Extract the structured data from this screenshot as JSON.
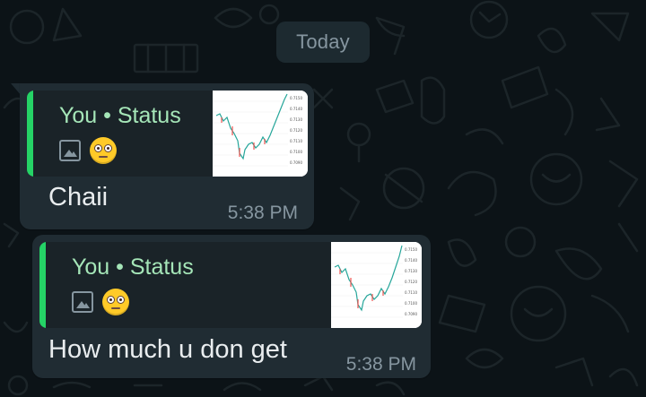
{
  "date_chip": {
    "label": "Today"
  },
  "messages": [
    {
      "quote": {
        "title": "You • Status",
        "media_icon": "image-icon",
        "emoji": "flushed-face"
      },
      "text": "Chaii",
      "time": "5:38 PM"
    },
    {
      "quote": {
        "title": "You • Status",
        "media_icon": "image-icon",
        "emoji": "flushed-face"
      },
      "text": "How much u don get",
      "time": "5:38 PM"
    }
  ],
  "colors": {
    "background": "#0c1317",
    "bubble": "#202c33",
    "quote_bar": "#25d366",
    "quote_title": "#a5e6b8",
    "text": "#e9edef",
    "meta": "#8696a0"
  }
}
